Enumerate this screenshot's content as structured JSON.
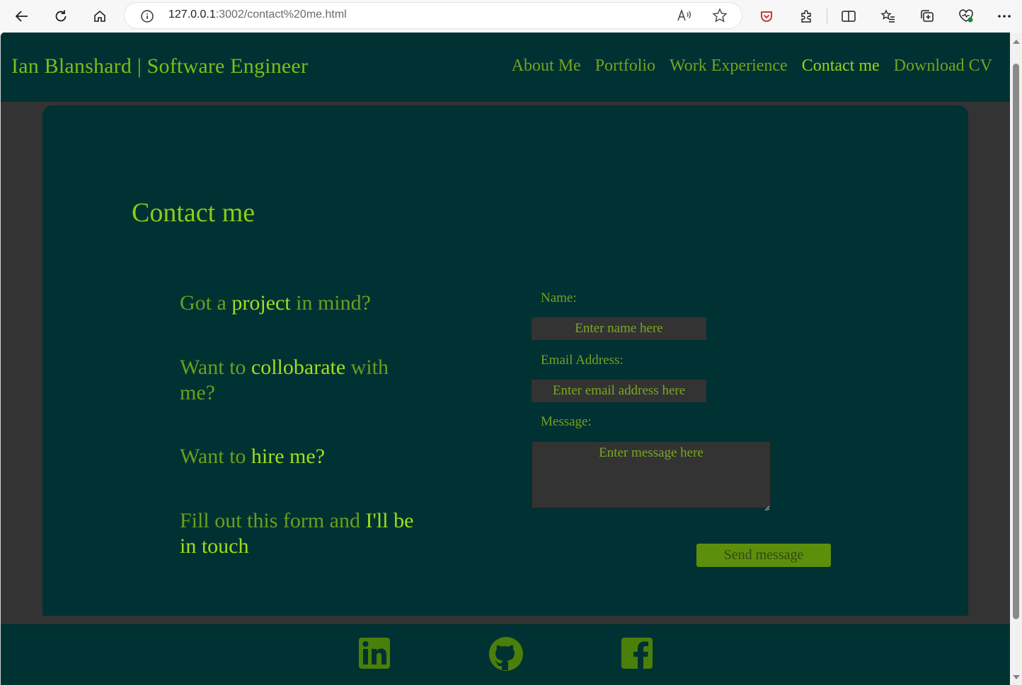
{
  "browser": {
    "url_host": "127.0.0.1",
    "url_rest": ":3002/contact%20me.html",
    "icons": [
      "back-arrow-icon",
      "refresh-icon",
      "home-icon",
      "info-icon",
      "read-aloud-icon",
      "favorite-star-icon",
      "pocket-icon",
      "extensions-icon",
      "split-screen-icon",
      "favorites-list-icon",
      "collections-icon",
      "browser-health-icon",
      "more-menu-icon"
    ]
  },
  "site": {
    "logo": "Ian Blanshard | Software Engineer",
    "nav": [
      {
        "label": "About Me",
        "active": false
      },
      {
        "label": "Portfolio",
        "active": false
      },
      {
        "label": "Work Experience",
        "active": false
      },
      {
        "label": "Contact me",
        "active": true
      },
      {
        "label": "Download CV",
        "active": false
      }
    ]
  },
  "main": {
    "heading": "Contact me",
    "pitch": [
      {
        "pre": "Got a ",
        "em": "project",
        "post": " in mind?"
      },
      {
        "pre": "Want to ",
        "em": "collobarate",
        "post": " with me?"
      },
      {
        "pre": "Want to ",
        "em": "hire me?",
        "post": ""
      },
      {
        "pre": "Fill out this form and ",
        "em": "I'll be in touch",
        "post": ""
      }
    ],
    "form": {
      "name_label": "Name:",
      "name_placeholder": "Enter name here",
      "email_label": "Email Address:",
      "email_placeholder": "Enter email address here",
      "message_label": "Message:",
      "message_placeholder": "Enter message here",
      "submit": "Send message"
    }
  },
  "footer": {
    "icons": [
      "linkedin-icon",
      "github-icon",
      "facebook-icon"
    ]
  },
  "colors": {
    "header_bg": "#003233",
    "page_bg": "#333333",
    "accent": "#98d318",
    "button": "#5d8f0c"
  }
}
